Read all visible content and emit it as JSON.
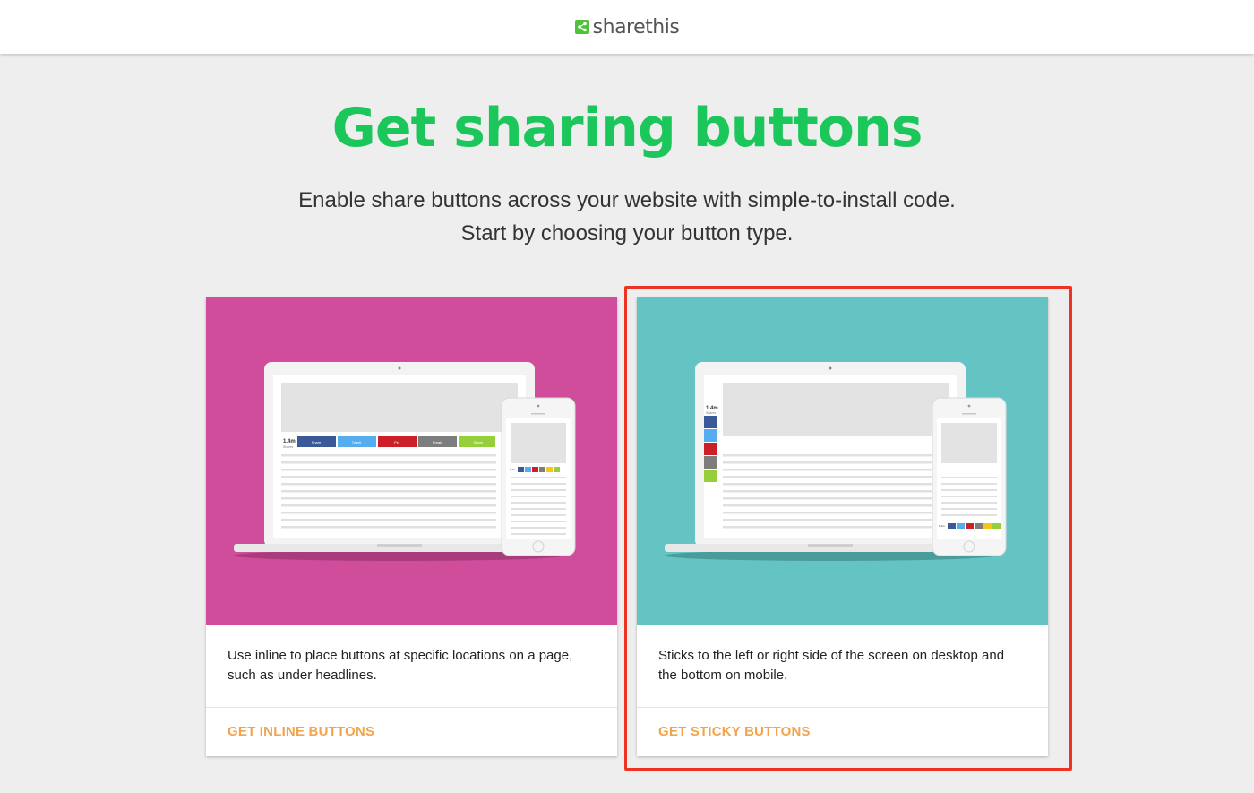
{
  "header": {
    "logo_text": "sharethis",
    "logo_icon": "share-icon"
  },
  "hero": {
    "title": "Get sharing buttons",
    "subtitle_line1": "Enable share buttons across your website with simple-to-install code.",
    "subtitle_line2": "Start by choosing your button type."
  },
  "cards": [
    {
      "id": "inline",
      "hero_color": "#d04d9c",
      "description": "Use inline to place buttons at specific locations on a page, such as under headlines.",
      "action_label": "GET INLINE BUTTONS",
      "illustration": {
        "share_count": "1.4m",
        "share_count_label": "Shares",
        "buttons": [
          "Share",
          "Tweet",
          "Pin",
          "Email",
          "Share"
        ]
      }
    },
    {
      "id": "sticky",
      "hero_color": "#63c4c3",
      "description": "Sticks to the left or right side of the screen on desktop and the bottom on mobile.",
      "action_label": "GET STICKY BUTTONS",
      "illustration": {
        "share_count": "1.4m",
        "share_count_label": "Shares"
      }
    }
  ],
  "colors": {
    "accent_green": "#1bc75b",
    "action_orange": "#f5a34b",
    "highlight_red": "#ee3223",
    "facebook": "#3b5998",
    "twitter": "#55acee",
    "pinterest": "#cb2027",
    "email": "#7d7d7d",
    "sharethis": "#95d03a"
  }
}
